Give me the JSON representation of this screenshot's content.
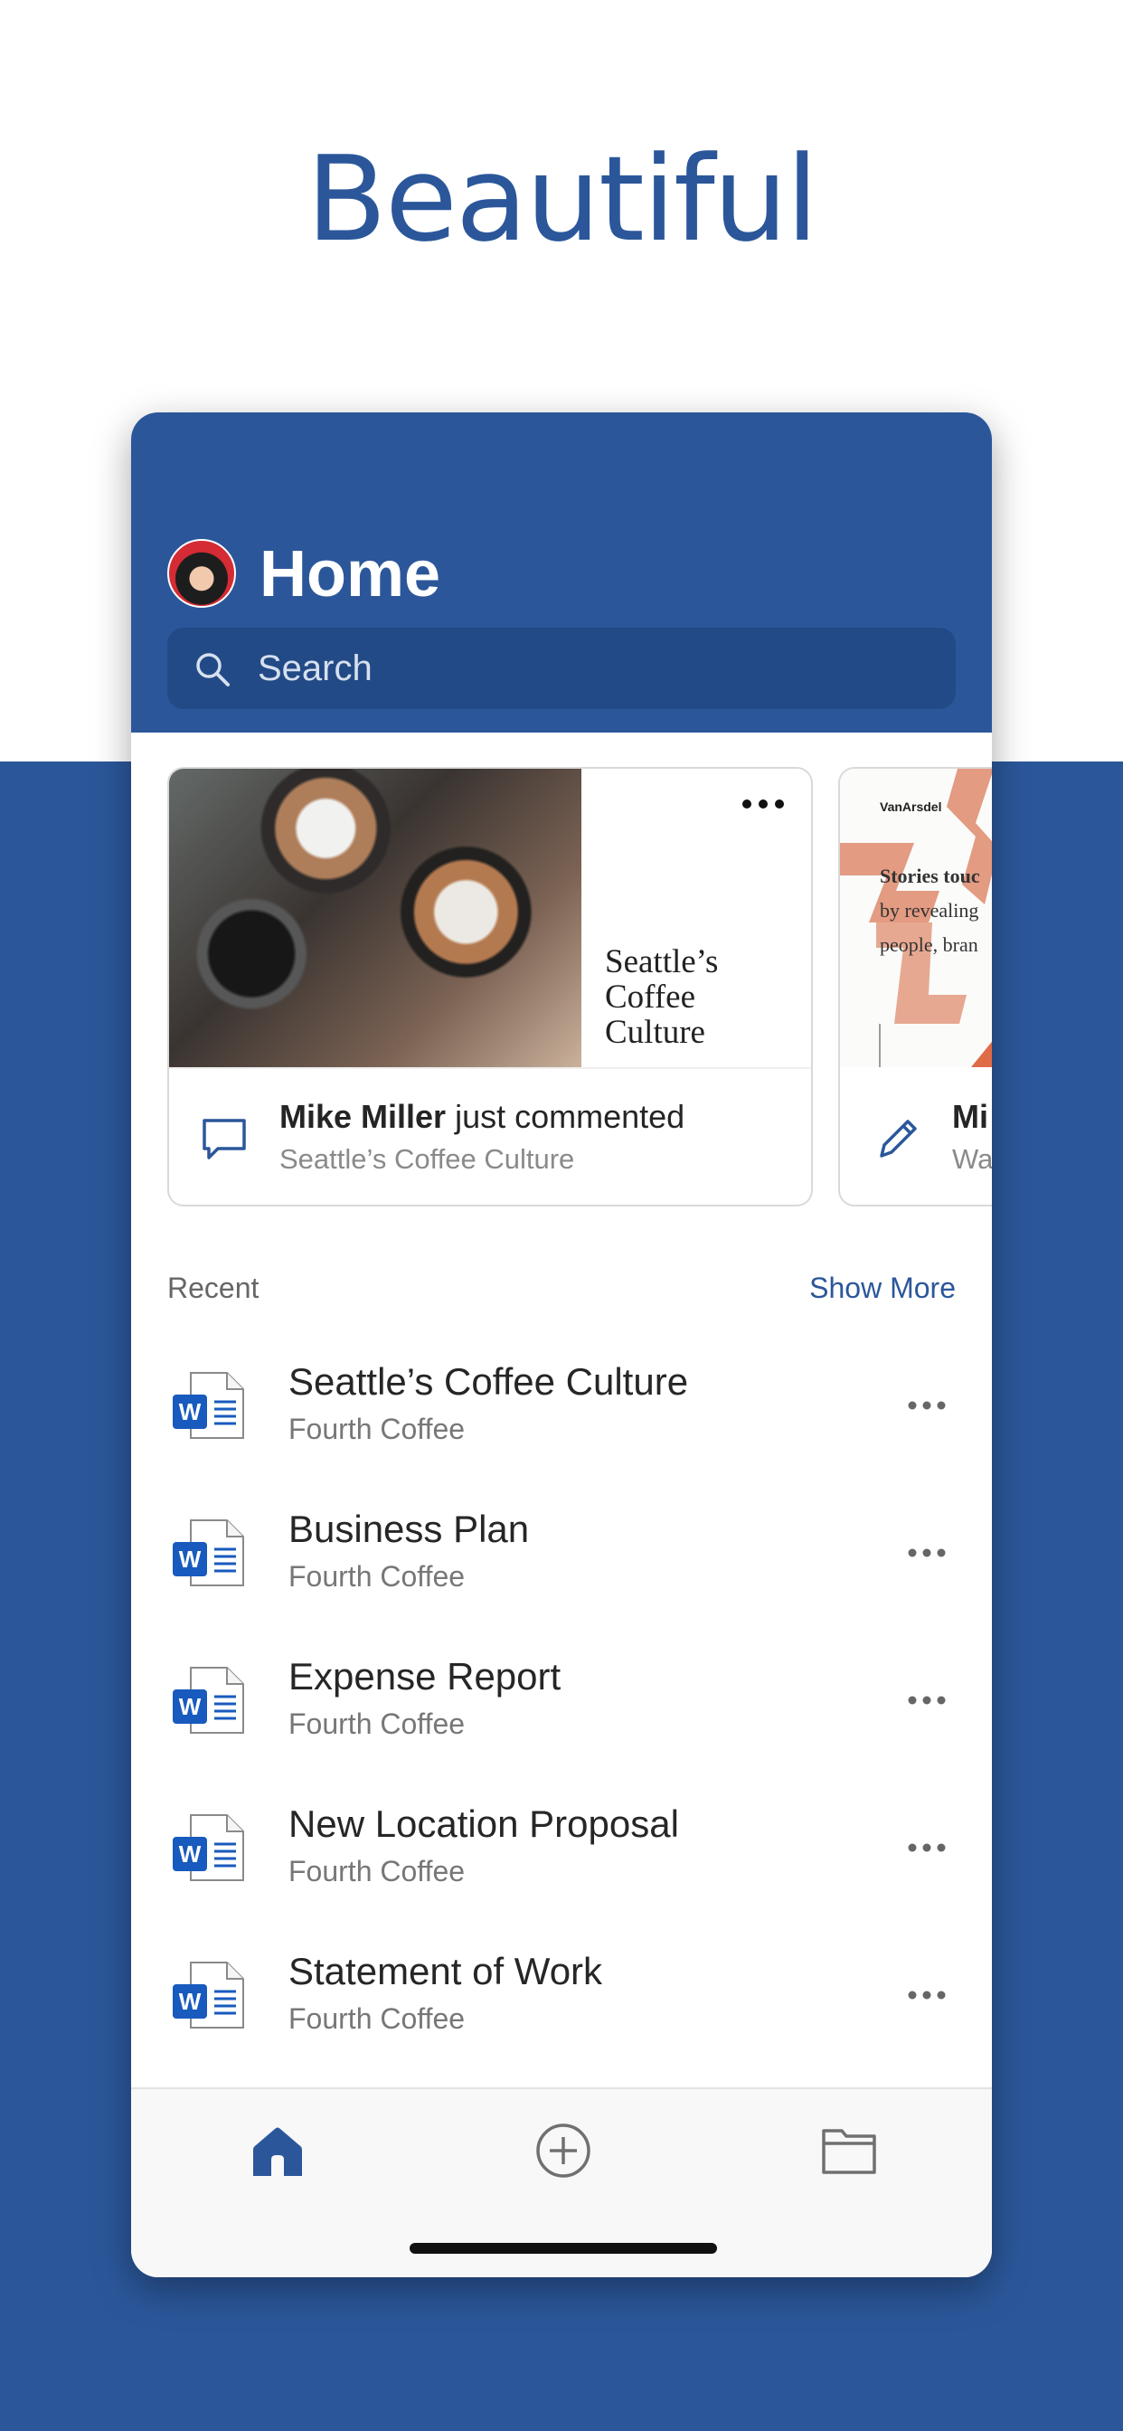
{
  "headline": "Beautiful",
  "header": {
    "title": "Home",
    "search_placeholder": "Search"
  },
  "activity_cards": [
    {
      "cover_title": "Seattle’s Coffee Culture",
      "author": "Mike Miller",
      "action": " just commented",
      "document": "Seattle’s Coffee Culture"
    },
    {
      "brand": "VanArsdel",
      "preview_lines": [
        "Stories touc",
        "by revealing",
        "people, bran"
      ],
      "author": "Mi",
      "document": "Wa"
    }
  ],
  "recent": {
    "label": "Recent",
    "show_more": "Show More",
    "items": [
      {
        "title": "Seattle’s Coffee Culture",
        "location": "Fourth Coffee",
        "icon_letter": "W"
      },
      {
        "title": "Business Plan",
        "location": "Fourth Coffee",
        "icon_letter": "W"
      },
      {
        "title": "Expense Report",
        "location": "Fourth Coffee",
        "icon_letter": "W"
      },
      {
        "title": "New Location Proposal",
        "location": "Fourth Coffee",
        "icon_letter": "W"
      },
      {
        "title": "Statement of Work",
        "location": "Fourth Coffee",
        "icon_letter": "W"
      }
    ]
  },
  "bottom_nav": {
    "items": [
      {
        "name": "home",
        "icon": "home-icon"
      },
      {
        "name": "new",
        "icon": "plus-circle-icon"
      },
      {
        "name": "open",
        "icon": "folder-icon"
      }
    ]
  },
  "colors": {
    "brand_blue": "#2b579a",
    "search_bg": "#224a86",
    "word_blue": "#185abd",
    "accent_coral": "#e39b82"
  }
}
